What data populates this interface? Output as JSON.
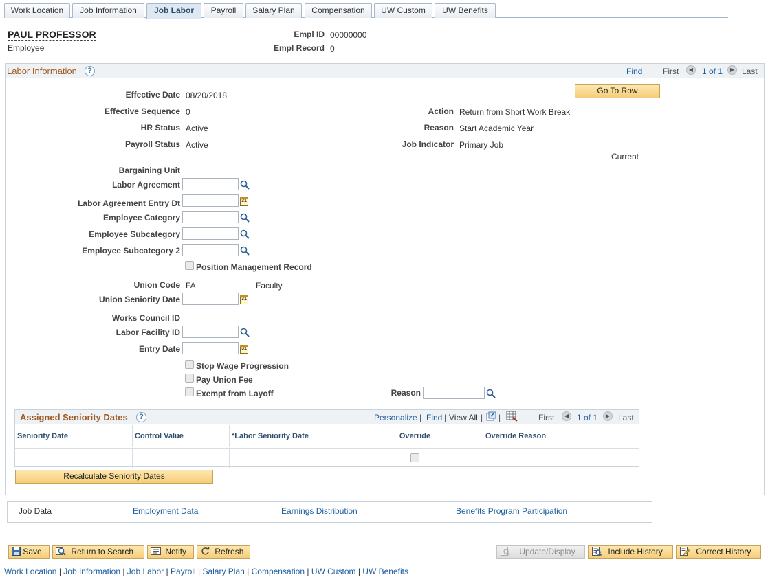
{
  "tabs": [
    {
      "label": "Work Location",
      "u": "W",
      "rest": "ork Location"
    },
    {
      "label": "Job Information",
      "u": "J",
      "rest": "ob Information"
    },
    {
      "label": "Job Labor",
      "u": "",
      "rest": "Job Labor"
    },
    {
      "label": "Payroll",
      "u": "P",
      "rest": "ayroll"
    },
    {
      "label": "Salary Plan",
      "u": "S",
      "rest": "alary Plan"
    },
    {
      "label": "Compensation",
      "u": "C",
      "rest": "ompensation"
    },
    {
      "label": "UW Custom",
      "u": "",
      "rest": "UW Custom"
    },
    {
      "label": "UW Benefits",
      "u": "",
      "rest": "UW Benefits"
    }
  ],
  "employee": {
    "name": "PAUL PROFESSOR",
    "type": "Employee",
    "empl_id_label": "Empl ID",
    "empl_id": "00000000",
    "empl_record_label": "Empl Record",
    "empl_record": "0"
  },
  "labor_info": {
    "title": "Labor Information",
    "find": "Find",
    "first": "First",
    "count": "1 of 1",
    "last": "Last",
    "go_to_row": "Go To Row",
    "current": "Current",
    "fields": {
      "effective_date_label": "Effective Date",
      "effective_date": "08/20/2018",
      "effective_sequence_label": "Effective Sequence",
      "effective_sequence": "0",
      "hr_status_label": "HR Status",
      "hr_status": "Active",
      "payroll_status_label": "Payroll Status",
      "payroll_status": "Active",
      "action_label": "Action",
      "action": "Return from Short Work Break",
      "reason_label": "Reason",
      "reason": "Start Academic Year",
      "job_indicator_label": "Job Indicator",
      "job_indicator": "Primary Job"
    },
    "bargaining_unit_label": "Bargaining Unit",
    "labor_agreement_label": "Labor Agreement",
    "labor_agreement_entry_dt_label": "Labor Agreement Entry Dt",
    "employee_category_label": "Employee Category",
    "employee_subcategory_label": "Employee Subcategory",
    "employee_subcategory2_label": "Employee Subcategory 2",
    "position_mgmt_label": "Position Management Record",
    "union_code_label": "Union Code",
    "union_code": "FA",
    "union_desc": "Faculty",
    "union_seniority_date_label": "Union Seniority Date",
    "works_council_label": "Works Council ID",
    "labor_facility_label": "Labor Facility ID",
    "entry_date_label": "Entry Date",
    "stop_wage_label": "Stop Wage Progression",
    "pay_union_fee_label": "Pay Union Fee",
    "exempt_layoff_label": "Exempt from Layoff",
    "layoff_reason_label": "Reason"
  },
  "seniority": {
    "title": "Assigned Seniority Dates",
    "personalize": "Personalize",
    "find": "Find",
    "view_all": "View All",
    "first": "First",
    "count": "1 of 1",
    "last": "Last",
    "columns": [
      "Seniority Date",
      "Control Value",
      "*Labor Seniority Date",
      "Override",
      "Override Reason"
    ],
    "recalculate": "Recalculate Seniority Dates"
  },
  "related_links": {
    "job_data": "Job Data",
    "employment_data": "Employment Data",
    "earnings_distribution": "Earnings Distribution",
    "benefits_program": "Benefits Program Participation"
  },
  "toolbar": {
    "save": "Save",
    "return_to_search": "Return to Search",
    "notify": "Notify",
    "refresh": "Refresh",
    "update_display": "Update/Display",
    "include_history": "Include History",
    "correct_history": "Correct History"
  },
  "bottom_links": [
    "Work Location",
    "Job Information",
    "Job Labor",
    "Payroll",
    "Salary Plan",
    "Compensation",
    "UW Custom",
    "UW Benefits"
  ]
}
